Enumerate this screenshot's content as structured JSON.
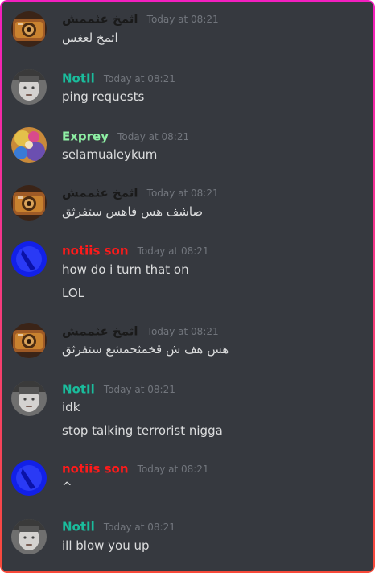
{
  "messages": [
    {
      "author": "اثمخ عثممش",
      "author_color": "#1a1a1a",
      "timestamp": "Today at 08:21",
      "avatar": "camera-avatar",
      "lines": [
        "اثمخ لعغس"
      ]
    },
    {
      "author": "NotIl",
      "author_color": "#1abc9c",
      "timestamp": "Today at 08:21",
      "avatar": "gray-face-avatar",
      "lines": [
        "ping requests"
      ]
    },
    {
      "author": "Exprey",
      "author_color": "#8ef0a4",
      "timestamp": "Today at 08:21",
      "avatar": "colorful-avatar",
      "lines": [
        "selamualeykum"
      ]
    },
    {
      "author": "اثمخ عثممش",
      "author_color": "#1a1a1a",
      "timestamp": "Today at 08:21",
      "avatar": "camera-avatar",
      "lines": [
        "صاشف هس فاهس ستفرثق"
      ]
    },
    {
      "author": "notiis son",
      "author_color": "#ff1a1a",
      "timestamp": "Today at 08:21",
      "avatar": "blue-avatar",
      "lines": [
        "how do i turn that on",
        "LOL"
      ]
    },
    {
      "author": "اثمخ عثممش",
      "author_color": "#1a1a1a",
      "timestamp": "Today at 08:21",
      "avatar": "camera-avatar",
      "lines": [
        "هس هف ش قخمثحمشع ستفرثق"
      ]
    },
    {
      "author": "NotIl",
      "author_color": "#1abc9c",
      "timestamp": "Today at 08:21",
      "avatar": "gray-face-avatar",
      "lines": [
        "idk",
        "stop talking terrorist nigga"
      ]
    },
    {
      "author": "notiis son",
      "author_color": "#ff1a1a",
      "timestamp": "Today at 08:21",
      "avatar": "blue-avatar",
      "lines": [
        "^"
      ]
    },
    {
      "author": "NotIl",
      "author_color": "#1abc9c",
      "timestamp": "Today at 08:21",
      "avatar": "gray-face-avatar",
      "lines": [
        "ill blow you up"
      ]
    }
  ]
}
